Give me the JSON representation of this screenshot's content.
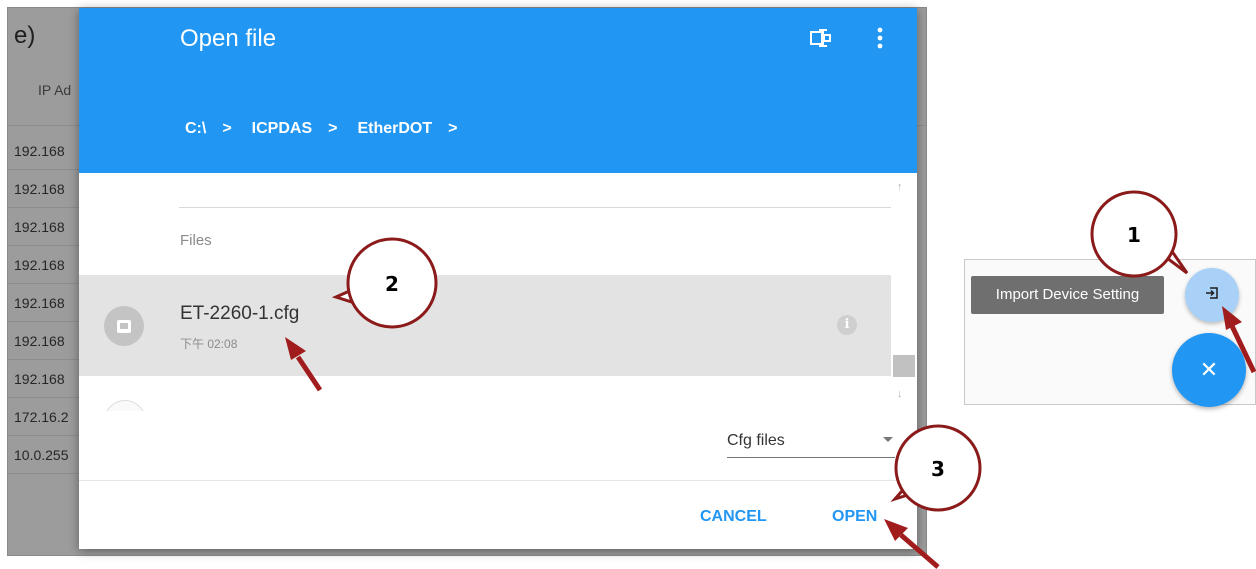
{
  "background": {
    "title": "e)",
    "column_header": "IP Ad",
    "rows": [
      "192.168",
      "192.168",
      "192.168",
      "192.168",
      "192.168",
      "192.168",
      "192.168",
      "172.16.2",
      "10.0.255"
    ]
  },
  "dialog": {
    "title": "Open file",
    "header_icons": [
      "device-import-icon",
      "more-vert-icon"
    ],
    "breadcrumb": [
      "C:\\",
      "ICPDAS",
      "EtherDOT"
    ],
    "section_label": "Files",
    "files": [
      {
        "name": "ET-2260-1.cfg",
        "time": "下午 02:08",
        "selected": true
      }
    ],
    "filter": {
      "selected": "Cfg files"
    },
    "buttons": {
      "cancel": "CANCEL",
      "open": "OPEN"
    }
  },
  "side_panel": {
    "tooltip": "Import Device Setting",
    "fab_small_icon": "import-icon",
    "fab_large_icon": "close-icon"
  },
  "callouts": [
    "1",
    "2",
    "3"
  ],
  "colors": {
    "primary": "#2196f3",
    "dim_background": "#9c9c9c",
    "selected_row": "#e3e3e3",
    "arrow": "#a11c1c"
  }
}
